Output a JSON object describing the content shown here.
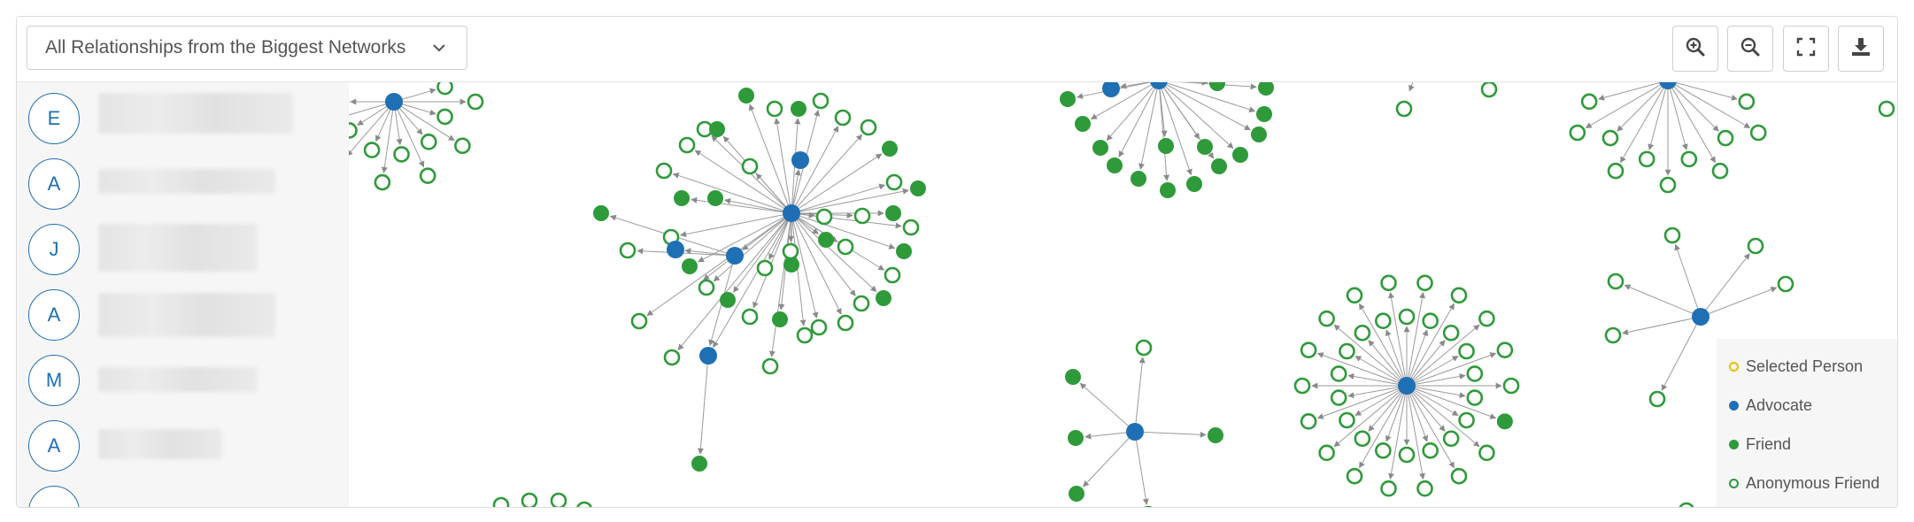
{
  "toolbar": {
    "view_select": {
      "label": "All Relationships from the Biggest Networks",
      "icon": "chevron-down-icon"
    },
    "buttons": [
      {
        "name": "zoom-in-button",
        "icon": "zoom-in-icon"
      },
      {
        "name": "zoom-out-button",
        "icon": "zoom-out-icon"
      },
      {
        "name": "fullscreen-button",
        "icon": "fullscreen-icon"
      },
      {
        "name": "download-button",
        "icon": "download-icon"
      }
    ]
  },
  "sidebar": {
    "people": [
      {
        "initial": "E"
      },
      {
        "initial": "A"
      },
      {
        "initial": "J"
      },
      {
        "initial": "A"
      },
      {
        "initial": "M"
      },
      {
        "initial": "A"
      },
      {
        "initial": ""
      }
    ]
  },
  "legend": {
    "items": [
      {
        "label": "Selected Person",
        "color": "#e6c000",
        "style": "hollow"
      },
      {
        "label": "Advocate",
        "color": "#1f6fb5",
        "style": "filled"
      },
      {
        "label": "Friend",
        "color": "#2e9a3a",
        "style": "filled"
      },
      {
        "label": "Anonymous Friend",
        "color": "#2e9a3a",
        "style": "hollow"
      }
    ]
  },
  "colors": {
    "advocate": "#1f6fb5",
    "friend": "#2e9a3a",
    "edge": "#9a9a9a",
    "selected": "#e6c000"
  }
}
